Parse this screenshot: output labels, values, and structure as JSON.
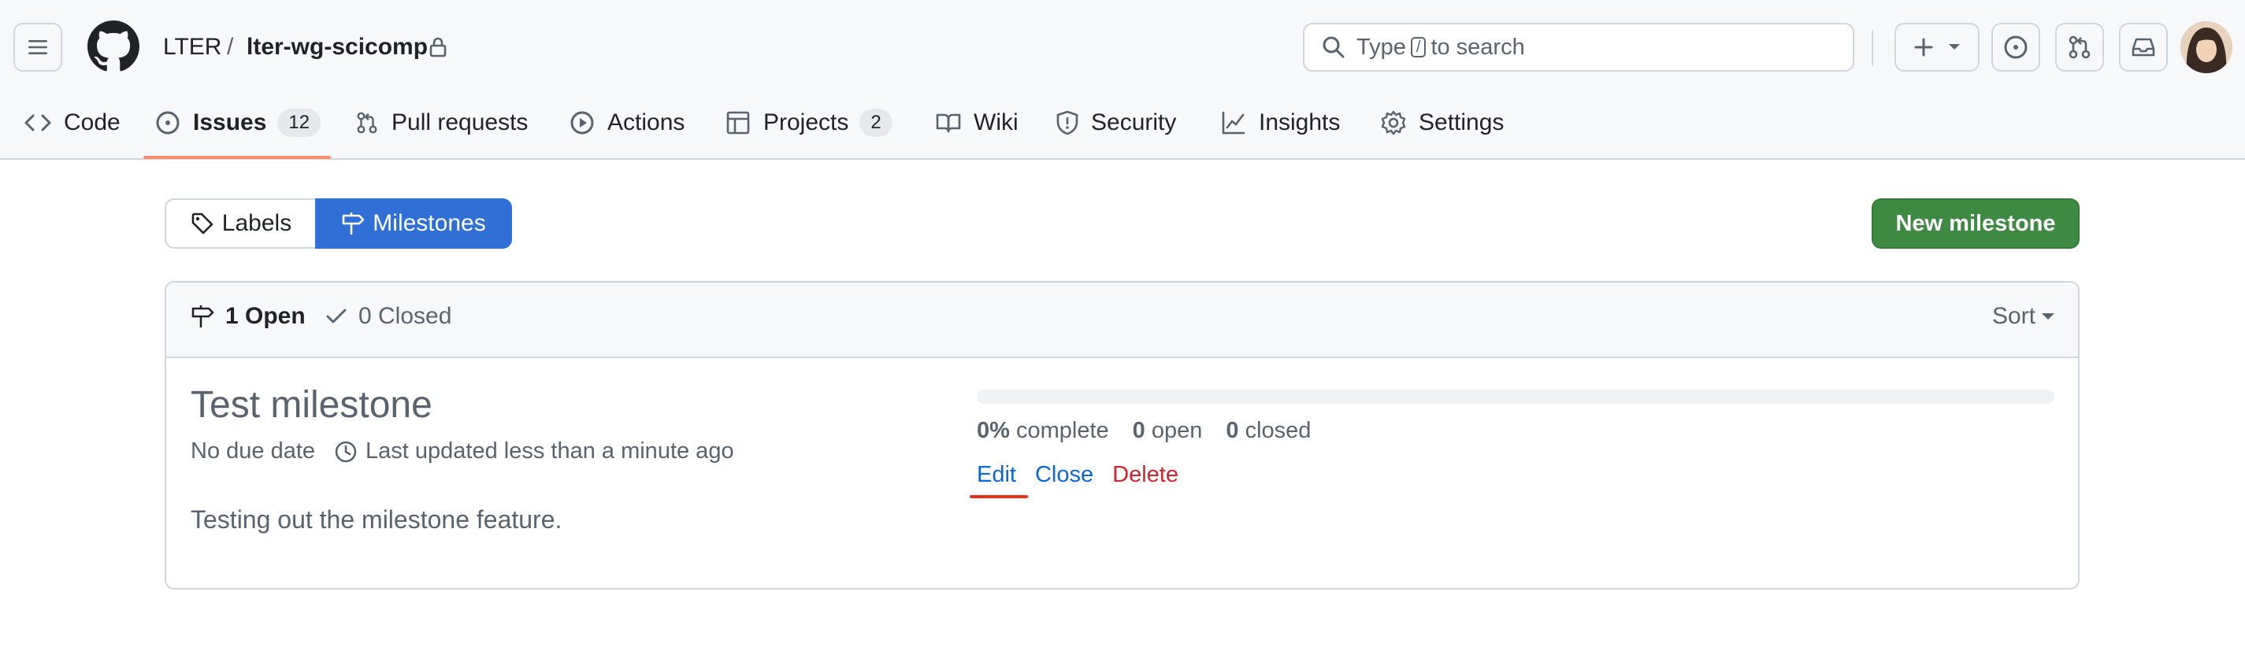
{
  "header": {
    "owner": "LTER",
    "separator": "/",
    "repo": "lter-wg-scicomp",
    "search": {
      "prefix": "Type",
      "key": "/",
      "suffix": "to search"
    }
  },
  "tabs": [
    {
      "label": "Code",
      "icon": "code-icon"
    },
    {
      "label": "Issues",
      "icon": "issue-opened-icon",
      "count": "12",
      "selected": true
    },
    {
      "label": "Pull requests",
      "icon": "git-pull-request-icon"
    },
    {
      "label": "Actions",
      "icon": "play-icon"
    },
    {
      "label": "Projects",
      "icon": "table-icon",
      "count": "2"
    },
    {
      "label": "Wiki",
      "icon": "book-icon"
    },
    {
      "label": "Security",
      "icon": "shield-icon"
    },
    {
      "label": "Insights",
      "icon": "graph-icon"
    },
    {
      "label": "Settings",
      "icon": "gear-icon"
    }
  ],
  "subnav": {
    "labels": "Labels",
    "milestones": "Milestones",
    "new_milestone": "New milestone"
  },
  "states": {
    "open": "1 Open",
    "closed": "0 Closed",
    "sort": "Sort"
  },
  "milestone": {
    "title": "Test milestone",
    "due": "No due date",
    "updated": "Last updated less than a minute ago",
    "description": "Testing out the milestone feature.",
    "percent": "0%",
    "percent_label": "complete",
    "progress_fraction": 0,
    "open_count": "0",
    "open_label": "open",
    "closed_count": "0",
    "closed_label": "closed",
    "edit": "Edit",
    "close": "Close",
    "delete": "Delete"
  },
  "colors": {
    "accent_blue": "#2f6fd6",
    "primary_green": "#3e8a43",
    "danger_red": "#d1242f",
    "link_blue": "#0969da"
  }
}
